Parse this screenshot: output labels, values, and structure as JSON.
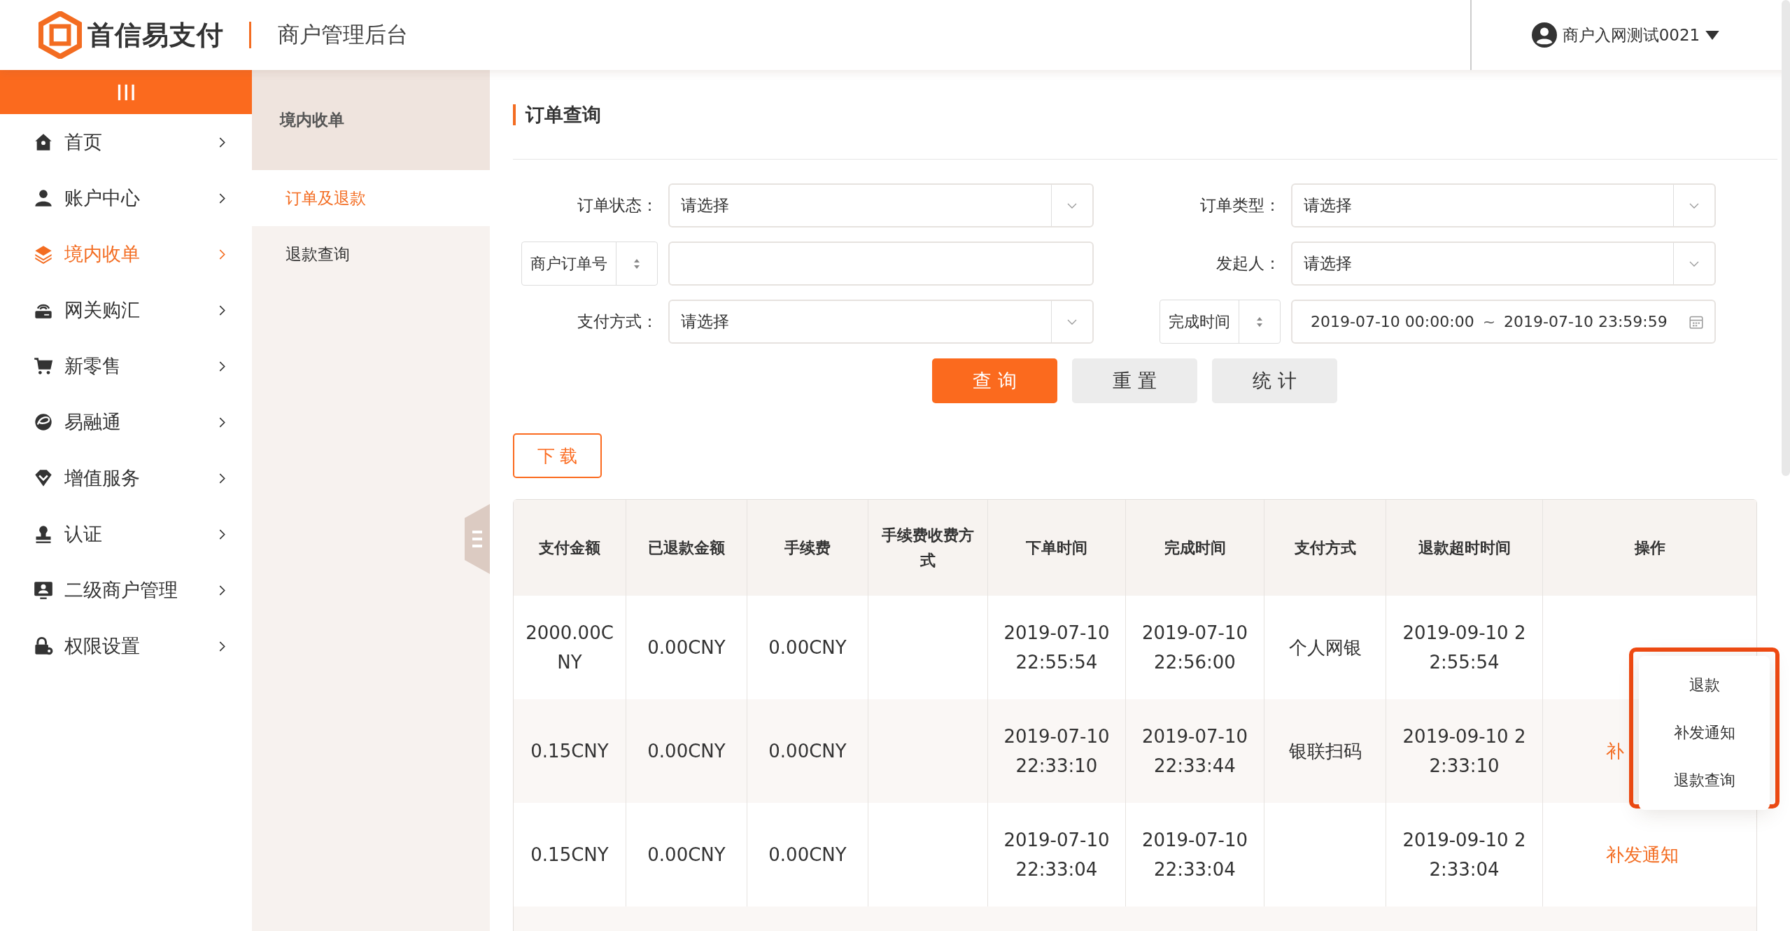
{
  "header": {
    "brand": "首信易支付",
    "app_title": "商户管理后台",
    "user": "商户入网测试0021"
  },
  "sidebar": {
    "items": [
      {
        "label": "首页",
        "selected": false
      },
      {
        "label": "账户中心",
        "selected": false
      },
      {
        "label": "境内收单",
        "selected": true
      },
      {
        "label": "网关购汇",
        "selected": false
      },
      {
        "label": "新零售",
        "selected": false
      },
      {
        "label": "易融通",
        "selected": false
      },
      {
        "label": "增值服务",
        "selected": false
      },
      {
        "label": "认证",
        "selected": false
      },
      {
        "label": "二级商户管理",
        "selected": false
      },
      {
        "label": "权限设置",
        "selected": false
      }
    ]
  },
  "subnav": {
    "title": "境内收单",
    "items": [
      {
        "label": "订单及退款",
        "selected": true
      },
      {
        "label": "退款查询",
        "selected": false
      }
    ]
  },
  "main": {
    "title": "订单查询",
    "filters": [
      {
        "label": "订单状态：",
        "label_selector": false,
        "kind": "select",
        "placeholder": "请选择"
      },
      {
        "label": "订单类型：",
        "label_selector": false,
        "kind": "select",
        "placeholder": "请选择"
      },
      {
        "label": "商户订单号",
        "label_selector": true,
        "kind": "text"
      },
      {
        "label": "发起人：",
        "label_selector": false,
        "kind": "select",
        "placeholder": "请选择"
      },
      {
        "label": "支付方式：",
        "label_selector": false,
        "kind": "select",
        "placeholder": "请选择"
      },
      {
        "label": "完成时间",
        "label_selector": true,
        "kind": "date_range",
        "start": "2019-07-10 00:00:00",
        "separator": "~",
        "end": "2019-07-10 23:59:59"
      }
    ],
    "buttons": [
      {
        "label": "查 询",
        "kind": "primary"
      },
      {
        "label": "重 置",
        "kind": "default"
      },
      {
        "label": "统 计",
        "kind": "default"
      }
    ],
    "download": "下 载",
    "table": {
      "columns": [
        "支付金额",
        "已退款金额",
        "手续费",
        "手续费收费方式",
        "下单时间",
        "完成时间",
        "支付方式",
        "退款超时时间",
        "操作"
      ],
      "rows": [
        {
          "cells": [
            "2000.00CNY",
            "0.00CNY",
            "0.00CNY",
            "",
            "2019-07-10 22:55:54",
            "2019-07-10 22:56:00",
            "个人网银",
            "2019-09-10 22:55:54"
          ],
          "action": ""
        },
        {
          "cells": [
            "0.15CNY",
            "0.00CNY",
            "0.00CNY",
            "",
            "2019-07-10 22:33:10",
            "2019-07-10 22:33:44",
            "银联扫码",
            "2019-09-10 22:33:10"
          ],
          "action": "补"
        },
        {
          "cells": [
            "0.15CNY",
            "0.00CNY",
            "0.00CNY",
            "",
            "2019-07-10 22:33:04",
            "2019-07-10 22:33:04",
            "",
            "2019-09-10 22:33:04"
          ],
          "action": "补发通知"
        }
      ]
    },
    "popup_menu": {
      "highlighted": true,
      "items": [
        "退款",
        "补发通知",
        "退款查询"
      ]
    }
  }
}
